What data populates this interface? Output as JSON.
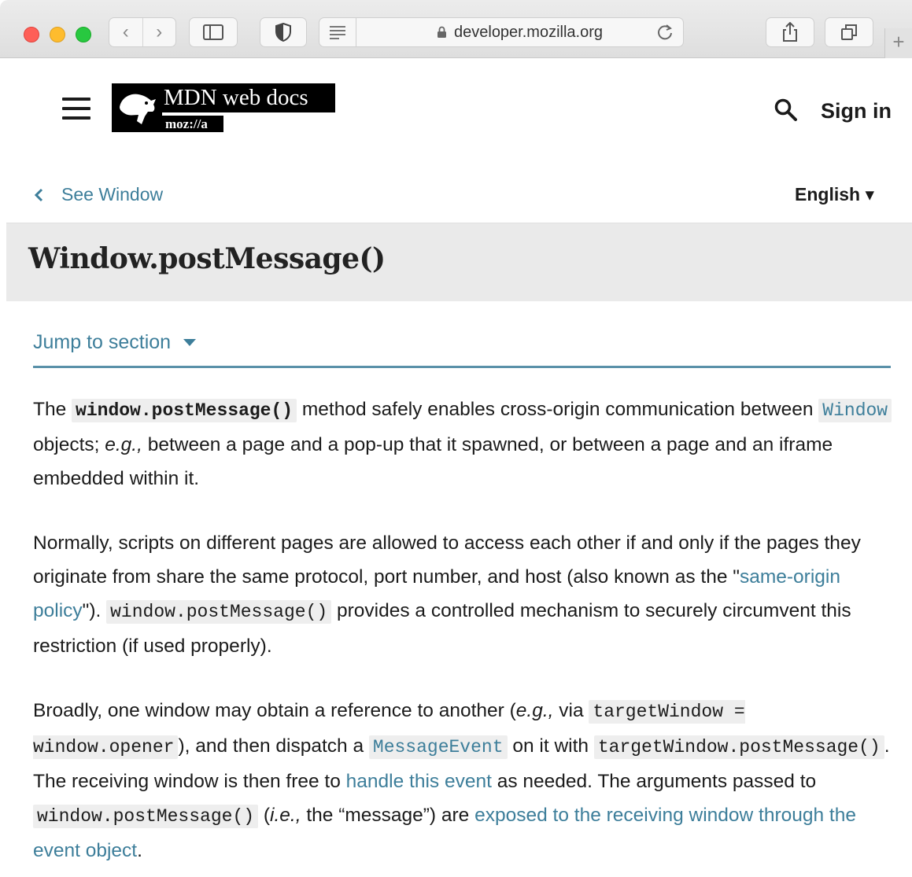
{
  "browser": {
    "address": "developer.mozilla.org",
    "nav_back_glyph": "‹",
    "nav_forward_glyph": "›",
    "new_tab_glyph": "+",
    "icons": [
      "back-icon",
      "forward-icon",
      "sidebar-icon",
      "shield-icon",
      "reader-icon",
      "lock-icon",
      "reload-icon",
      "share-icon",
      "tabs-icon",
      "plus-icon"
    ]
  },
  "header": {
    "logo_title": "MDN web docs",
    "logo_sub": "moz://a",
    "signin": "Sign in",
    "icons": [
      "menu-icon",
      "mdn-dino-logo",
      "search-icon"
    ]
  },
  "breadcrumb": {
    "back_label": "See Window",
    "language": "English ▾"
  },
  "page": {
    "title": "Window.postMessage()",
    "jump_label": "Jump to section"
  },
  "article": {
    "p1": {
      "t1": "The ",
      "code1": "window.postMessage()",
      "t2": " method safely enables cross-origin communication between ",
      "link1": "Window",
      "t3": " objects; ",
      "em1": "e.g.,",
      "t4": " between a page and a pop-up that it spawned, or between a page and an iframe embedded within it."
    },
    "p2": {
      "t1": "Normally, scripts on different pages are allowed to access each other if and only if the pages they originate from share the same protocol, port number, and host (also known as the \"",
      "link1": "same-origin policy",
      "t2": "\"). ",
      "code1": "window.postMessage()",
      "t3": " provides a controlled mechanism to securely circumvent this restriction (if used properly)."
    },
    "p3": {
      "t1": "Broadly, one window may obtain a reference to another (",
      "em1": "e.g.,",
      "t2": " via ",
      "code1": "targetWindow = window.opener",
      "t3": "), and then dispatch a ",
      "link1": "MessageEvent",
      "t4": " on it with ",
      "code2": "targetWindow.postMessage()",
      "t5": ". The receiving window is then free to ",
      "link2": "handle this event",
      "t6": " as needed. The arguments passed to ",
      "code3": "window.postMessage()",
      "t7": " (",
      "em2": "i.e.,",
      "t8": " the “message”) are ",
      "link3": "exposed to the receiving window through the event object",
      "t9": "."
    }
  },
  "colors": {
    "link": "#3d7e9a",
    "title_band": "#eaeaea",
    "code_bg": "#eeeeee",
    "text": "#1b1b1b"
  }
}
